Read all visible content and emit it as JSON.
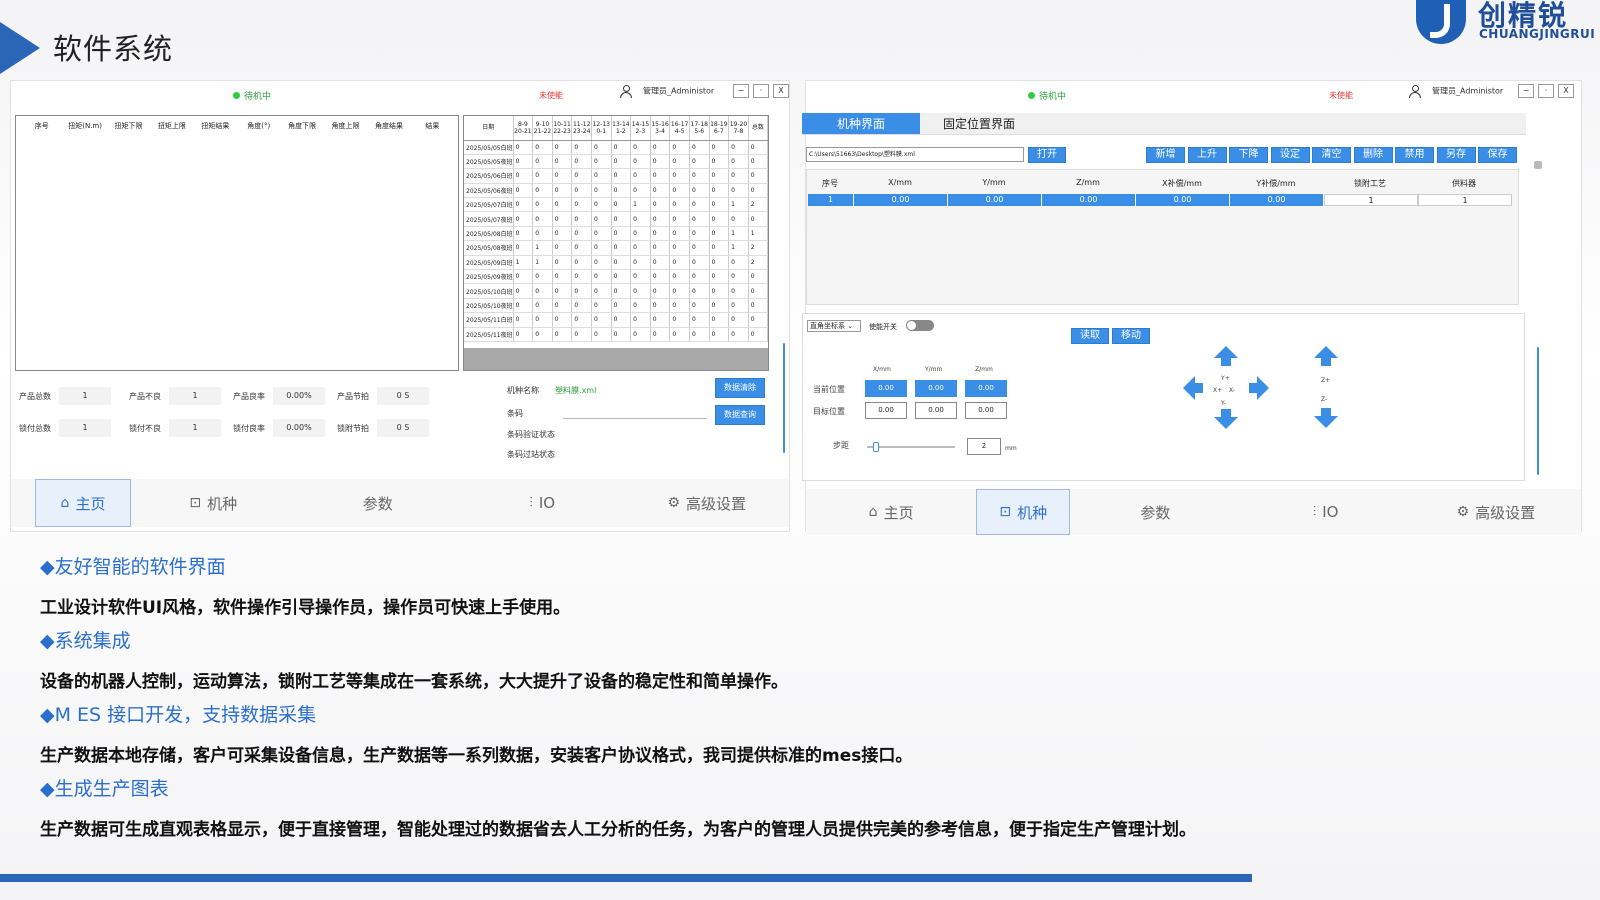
{
  "slide": {
    "title": "软件系统"
  },
  "logo": {
    "cn": "创精锐",
    "en": "CHUANGJINGRUI"
  },
  "left_panel": {
    "status": "待机中",
    "enable_status": "未使能",
    "user": "管理员_Administor",
    "win_buttons": [
      "−",
      "·",
      "X"
    ],
    "result_headers": [
      "序号",
      "扭矩(N.m)",
      "扭矩下限",
      "扭矩上限",
      "扭矩结果",
      "角度(°)",
      "角度下限",
      "角度上限",
      "角度结果",
      "结果"
    ],
    "stats_headers": [
      "日期",
      "8-9 20-21",
      "9-10 21-22",
      "10-11 22-23",
      "11-12 23-24",
      "12-13 0-1",
      "13-14 1-2",
      "14-15 2-3",
      "15-16 3-4",
      "16-17 4-5",
      "17-18 5-6",
      "18-19 6-7",
      "19-20 7-8",
      "总数"
    ],
    "stats_rows": [
      [
        "2025/05/05白班",
        "0",
        "0",
        "0",
        "0",
        "0",
        "0",
        "0",
        "0",
        "0",
        "0",
        "0",
        "0",
        "0"
      ],
      [
        "2025/05/05夜班",
        "0",
        "0",
        "0",
        "0",
        "0",
        "0",
        "0",
        "0",
        "0",
        "0",
        "0",
        "0",
        "0"
      ],
      [
        "2025/05/06白班",
        "0",
        "0",
        "0",
        "0",
        "0",
        "0",
        "0",
        "0",
        "0",
        "0",
        "0",
        "0",
        "0"
      ],
      [
        "2025/05/06夜班",
        "0",
        "0",
        "0",
        "0",
        "0",
        "0",
        "0",
        "0",
        "0",
        "0",
        "0",
        "0",
        "0"
      ],
      [
        "2025/05/07白班",
        "0",
        "0",
        "0",
        "0",
        "0",
        "0",
        "1",
        "0",
        "0",
        "0",
        "0",
        "1",
        "2"
      ],
      [
        "2025/05/07夜班",
        "0",
        "0",
        "0",
        "0",
        "0",
        "0",
        "0",
        "0",
        "0",
        "0",
        "0",
        "0",
        "0"
      ],
      [
        "2025/05/08白班",
        "0",
        "0",
        "0",
        "0",
        "0",
        "0",
        "0",
        "0",
        "0",
        "0",
        "0",
        "1",
        "1"
      ],
      [
        "2025/05/08夜班",
        "0",
        "1",
        "0",
        "0",
        "0",
        "0",
        "0",
        "0",
        "0",
        "0",
        "0",
        "1",
        "2"
      ],
      [
        "2025/05/09白班",
        "1",
        "1",
        "0",
        "0",
        "0",
        "0",
        "0",
        "0",
        "0",
        "0",
        "0",
        "0",
        "2"
      ],
      [
        "2025/05/09夜班",
        "0",
        "0",
        "0",
        "0",
        "0",
        "0",
        "0",
        "0",
        "0",
        "0",
        "0",
        "0",
        "0"
      ],
      [
        "2025/05/10白班",
        "0",
        "0",
        "0",
        "0",
        "0",
        "0",
        "0",
        "0",
        "0",
        "0",
        "0",
        "0",
        "0"
      ],
      [
        "2025/05/10夜班",
        "0",
        "0",
        "0",
        "0",
        "0",
        "0",
        "0",
        "0",
        "0",
        "0",
        "0",
        "0",
        "0"
      ],
      [
        "2025/05/11白班",
        "0",
        "0",
        "0",
        "0",
        "0",
        "0",
        "0",
        "0",
        "0",
        "0",
        "0",
        "0",
        "0"
      ],
      [
        "2025/05/11夜班",
        "0",
        "0",
        "0",
        "0",
        "0",
        "0",
        "0",
        "0",
        "0",
        "0",
        "0",
        "0",
        "0"
      ]
    ],
    "counters": {
      "prod_total_label": "产品总数",
      "prod_total": "1",
      "prod_bad_label": "产品不良",
      "prod_bad": "1",
      "prod_rate_label": "产品良率",
      "prod_rate": "0.00%",
      "prod_beat_label": "产品节拍",
      "prod_beat": "0 S",
      "lock_total_label": "锁付总数",
      "lock_total": "1",
      "lock_bad_label": "锁付不良",
      "lock_bad": "1",
      "lock_rate_label": "锁付良率",
      "lock_rate": "0.00%",
      "lock_beat_label": "锁附节拍",
      "lock_beat": "0 S"
    },
    "model_name_label": "机种名称",
    "model_name": "塑料膜.xml",
    "barcode_label": "条码",
    "barcode_verify_label": "条码验证状态",
    "barcode_pass_label": "条码过站状态",
    "btn_clear": "数据清除",
    "btn_query": "数据查询",
    "nav": [
      "主页",
      "机种",
      "参数",
      "IO",
      "高级设置"
    ]
  },
  "right_panel": {
    "status": "待机中",
    "enable_status": "未使能",
    "user": "管理员_Administor",
    "win_buttons": [
      "−",
      "·",
      "X"
    ],
    "tabs": [
      "机种界面",
      "固定位置界面"
    ],
    "path": "C:\\Users\\51663\\Desktop\\塑料膜.xml",
    "btn_open": "打开",
    "actions": [
      "新增",
      "上升",
      "下降",
      "设定",
      "清空",
      "删除",
      "禁用",
      "另存",
      "保存"
    ],
    "grid_headers": [
      "序号",
      "X/mm",
      "Y/mm",
      "Z/mm",
      "X补偿/mm",
      "Y补偿/mm",
      "锁附工艺",
      "供料器"
    ],
    "grid_row": [
      "1",
      "0.00",
      "0.00",
      "0.00",
      "0.00",
      "0.00",
      "1",
      "1"
    ],
    "coord_system": "直角坐标系",
    "enable_switch_label": "使能开关",
    "btn_read": "读取",
    "btn_move": "移动",
    "axis_headers": [
      "X/mm",
      "Y/mm",
      "Z/mm"
    ],
    "current_pos_label": "当前位置",
    "current_pos": [
      "0.00",
      "0.00",
      "0.00"
    ],
    "target_pos_label": "目标位置",
    "target_pos": [
      "0.00",
      "0.00",
      "0.00"
    ],
    "step_label": "步距",
    "step_value": "2",
    "step_unit": "mm",
    "jog_labels": {
      "yplus": "Y+",
      "yminus": "Y-",
      "xplus": "X+",
      "xminus": "X-",
      "zplus": "Z+",
      "zminus": "Z-"
    },
    "nav": [
      "主页",
      "机种",
      "参数",
      "IO",
      "高级设置"
    ]
  },
  "features": [
    {
      "title": "◆友好智能的软件界面",
      "text": "工业设计软件UI风格，软件操作引导操作员，操作员可快速上手使用。"
    },
    {
      "title": "◆系统集成",
      "text": "设备的机器人控制，运动算法，锁附工艺等集成在一套系统，大大提升了设备的稳定性和简单操作。"
    },
    {
      "title": "◆M ES 接口开发，支持数据采集",
      "text": "生产数据本地存储，客户可采集设备信息，生产数据等一系列数据，安装客户协议格式，我司提供标准的mes接口。"
    },
    {
      "title": "◆生成生产图表",
      "text": "生产数据可生成直观表格显示，便于直接管理，智能处理过的数据省去人工分析的任务，为客户的管理人员提供完美的参考信息，便于指定生产管理计划。"
    }
  ]
}
